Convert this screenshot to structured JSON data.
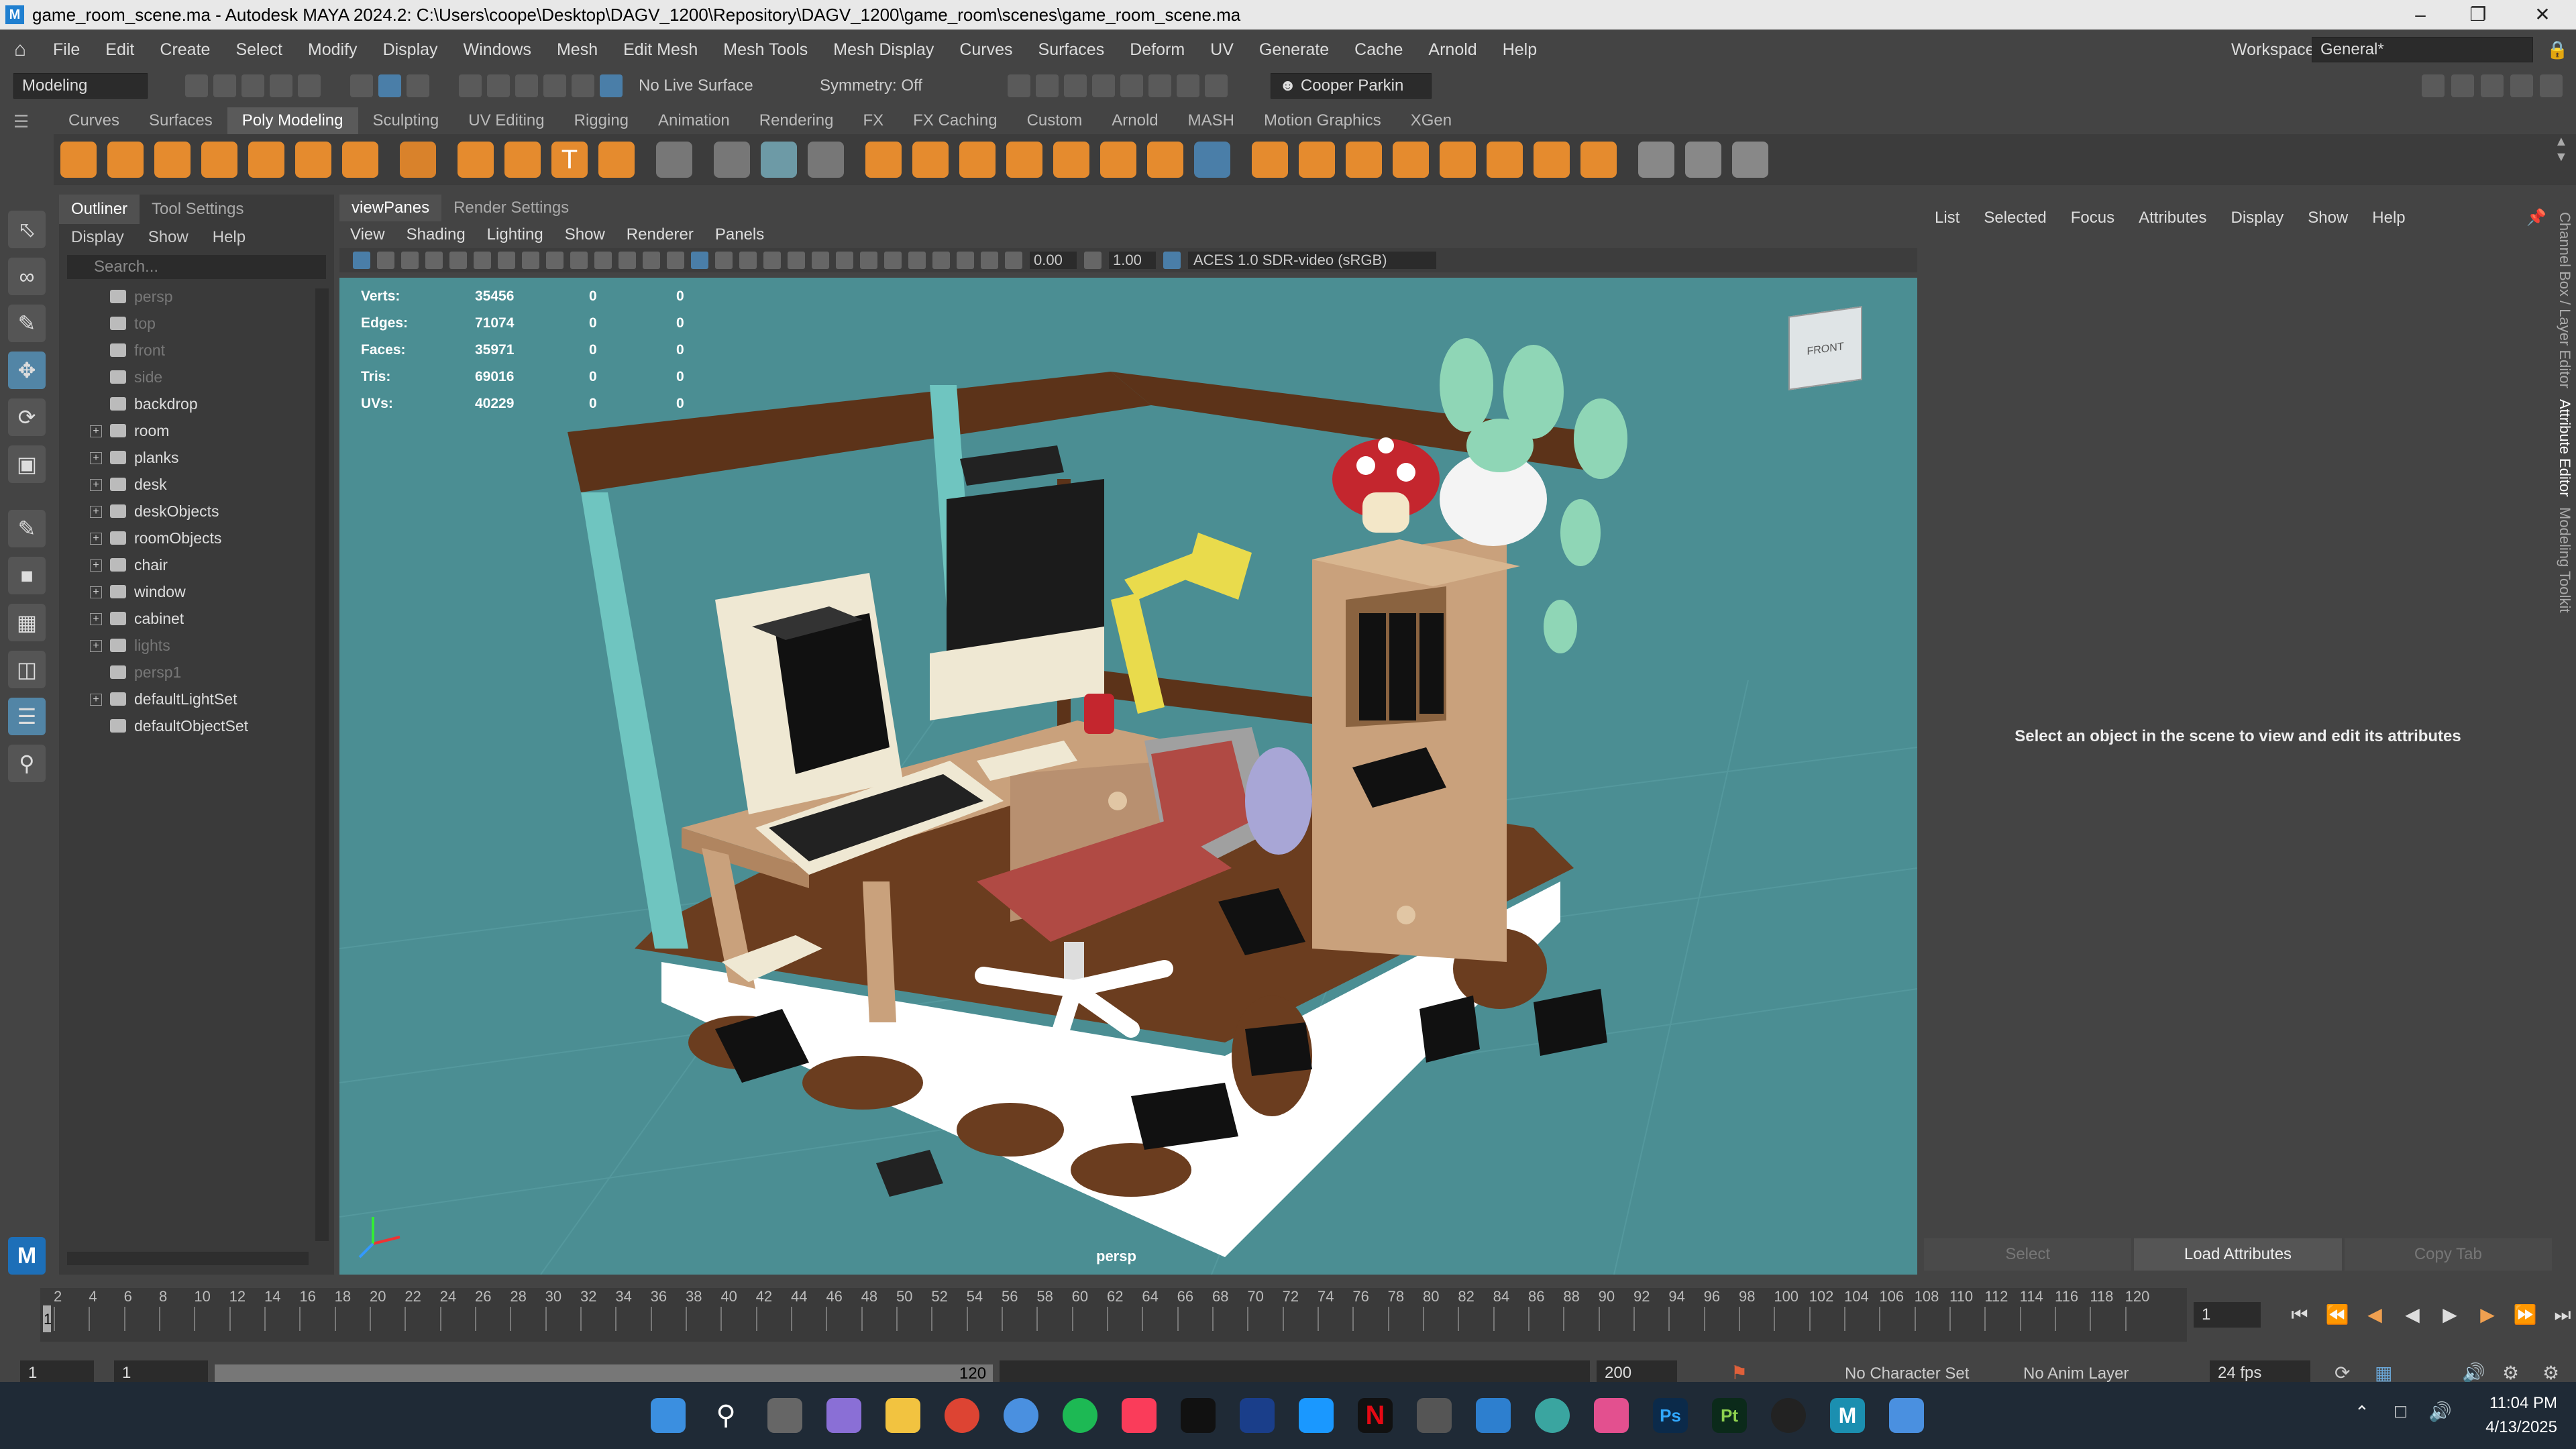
{
  "window": {
    "title": "game_room_scene.ma - Autodesk MAYA 2024.2: C:\\Users\\coope\\Desktop\\DAGV_1200\\Repository\\DAGV_1200\\game_room\\scenes\\game_room_scene.ma",
    "logo": "M"
  },
  "menus": [
    "File",
    "Edit",
    "Create",
    "Select",
    "Modify",
    "Display",
    "Windows",
    "Mesh",
    "Edit Mesh",
    "Mesh Tools",
    "Mesh Display",
    "Curves",
    "Surfaces",
    "Deform",
    "UV",
    "Generate",
    "Cache",
    "Arnold",
    "Help"
  ],
  "workspace": {
    "label": "Workspace:",
    "value": "General*"
  },
  "statusline": {
    "mode": "Modeling",
    "live_surface": "No Live Surface",
    "symmetry": "Symmetry: Off",
    "user": "Cooper Parkin"
  },
  "shelf_tabs": [
    "Curves",
    "Surfaces",
    "Poly Modeling",
    "Sculpting",
    "UV Editing",
    "Rigging",
    "Animation",
    "Rendering",
    "FX",
    "FX Caching",
    "Custom",
    "Arnold",
    "MASH",
    "Motion Graphics",
    "XGen"
  ],
  "outliner": {
    "tabs": [
      "Outliner",
      "Tool Settings"
    ],
    "menu": [
      "Display",
      "Show",
      "Help"
    ],
    "search_placeholder": "Search...",
    "items": [
      {
        "name": "persp",
        "dim": true,
        "exp": false
      },
      {
        "name": "top",
        "dim": true,
        "exp": false
      },
      {
        "name": "front",
        "dim": true,
        "exp": false
      },
      {
        "name": "side",
        "dim": true,
        "exp": false
      },
      {
        "name": "backdrop",
        "dim": false,
        "exp": false
      },
      {
        "name": "room",
        "dim": false,
        "exp": true
      },
      {
        "name": "planks",
        "dim": false,
        "exp": true
      },
      {
        "name": "desk",
        "dim": false,
        "exp": true
      },
      {
        "name": "deskObjects",
        "dim": false,
        "exp": true
      },
      {
        "name": "roomObjects",
        "dim": false,
        "exp": true
      },
      {
        "name": "chair",
        "dim": false,
        "exp": true
      },
      {
        "name": "window",
        "dim": false,
        "exp": true
      },
      {
        "name": "cabinet",
        "dim": false,
        "exp": true
      },
      {
        "name": "lights",
        "dim": true,
        "exp": true
      },
      {
        "name": "persp1",
        "dim": true,
        "exp": false
      },
      {
        "name": "defaultLightSet",
        "dim": false,
        "exp": true
      },
      {
        "name": "defaultObjectSet",
        "dim": false,
        "exp": false
      }
    ]
  },
  "viewport": {
    "tabs": [
      "viewPanes",
      "Render Settings"
    ],
    "menu": [
      "View",
      "Shading",
      "Lighting",
      "Show",
      "Renderer",
      "Panels"
    ],
    "exposure": "0.00",
    "gamma": "1.00",
    "colorspace": "ACES 1.0 SDR-video (sRGB)",
    "camera": "persp",
    "cube_label": "FRONT",
    "hud": [
      {
        "label": "Verts:",
        "a": "35456",
        "b": "0",
        "c": "0"
      },
      {
        "label": "Edges:",
        "a": "71074",
        "b": "0",
        "c": "0"
      },
      {
        "label": "Faces:",
        "a": "35971",
        "b": "0",
        "c": "0"
      },
      {
        "label": "Tris:",
        "a": "69016",
        "b": "0",
        "c": "0"
      },
      {
        "label": "UVs:",
        "a": "40229",
        "b": "0",
        "c": "0"
      }
    ]
  },
  "attribute_editor": {
    "menu": [
      "List",
      "Selected",
      "Focus",
      "Attributes",
      "Display",
      "Show",
      "Help"
    ],
    "message": "Select an object in the scene to view and edit its attributes",
    "buttons": [
      "Select",
      "Load Attributes",
      "Copy Tab"
    ],
    "side_tabs": [
      "Channel Box / Layer Editor",
      "Attribute Editor",
      "Modeling Toolkit"
    ]
  },
  "timeline": {
    "ticks": [
      "2",
      "4",
      "6",
      "8",
      "10",
      "12",
      "14",
      "16",
      "18",
      "20",
      "22",
      "24",
      "26",
      "28",
      "30",
      "32",
      "34",
      "36",
      "38",
      "40",
      "42",
      "44",
      "46",
      "48",
      "50",
      "52",
      "54",
      "56",
      "58",
      "60",
      "62",
      "64",
      "66",
      "68",
      "70",
      "72",
      "74",
      "76",
      "78",
      "80",
      "82",
      "84",
      "86",
      "88",
      "90",
      "92",
      "94",
      "96",
      "98",
      "100",
      "102",
      "104",
      "106",
      "108",
      "110",
      "112",
      "114",
      "116",
      "118",
      "120"
    ],
    "current": "1",
    "current_frame_box": "1"
  },
  "range": {
    "start": "1",
    "inner_start": "1",
    "inner_end": "120",
    "end": "200",
    "character_set": "No Character Set",
    "anim_layer": "No Anim Layer",
    "fps": "24 fps"
  },
  "clock": {
    "time": "11:04 PM",
    "date": "4/13/2025"
  }
}
